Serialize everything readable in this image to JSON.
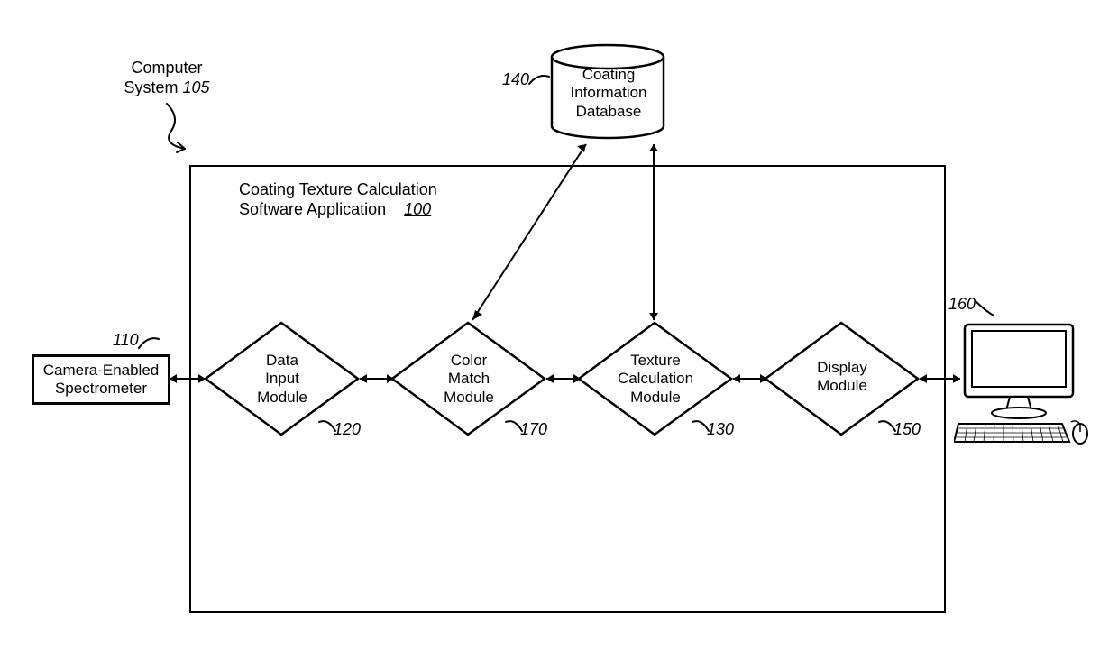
{
  "title_system": "Computer\nSystem",
  "title_system_ref": "105",
  "app_box_label": "Coating Texture Calculation\nSoftware Application",
  "app_box_ref": "100",
  "spectrometer": "Camera-Enabled\nSpectrometer",
  "spectrometer_ref": "110",
  "database": "Coating\nInformation\nDatabase",
  "database_ref": "140",
  "module_data_input": "Data\nInput\nModule",
  "module_data_input_ref": "120",
  "module_color_match": "Color\nMatch\nModule",
  "module_color_match_ref": "170",
  "module_texture_calc": "Texture\nCalculation\nModule",
  "module_texture_calc_ref": "130",
  "module_display": "Display\nModule",
  "module_display_ref": "150",
  "computer_ref": "160"
}
